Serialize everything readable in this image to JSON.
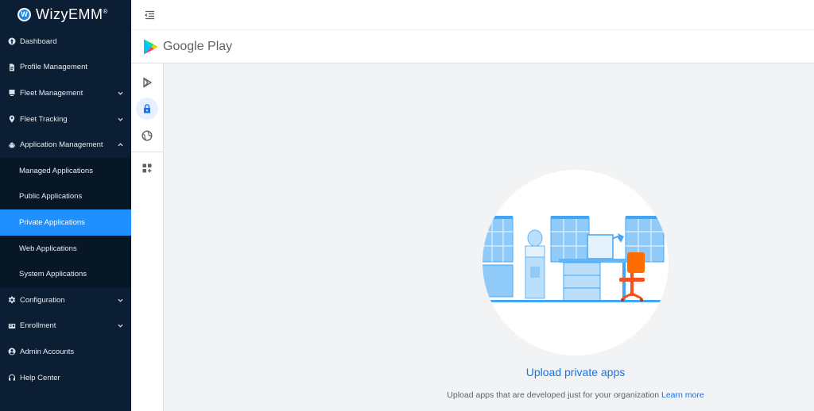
{
  "app": {
    "logo_badge": "W",
    "logo_text": "WizyEMM",
    "logo_mark": "®"
  },
  "sidebar": {
    "items": [
      {
        "label": "Dashboard",
        "icon": "dashboard-icon",
        "expandable": false
      },
      {
        "label": "Profile Management",
        "icon": "document-icon",
        "expandable": false
      },
      {
        "label": "Fleet Management",
        "icon": "fleet-icon",
        "expandable": true,
        "state": "collapsed"
      },
      {
        "label": "Fleet Tracking",
        "icon": "location-pin-icon",
        "expandable": true,
        "state": "collapsed"
      },
      {
        "label": "Application Management",
        "icon": "android-icon",
        "expandable": true,
        "state": "expanded"
      },
      {
        "label": "Configuration",
        "icon": "gear-icon",
        "expandable": true,
        "state": "collapsed"
      },
      {
        "label": "Enrollment",
        "icon": "enrollment-icon",
        "expandable": true,
        "state": "collapsed"
      },
      {
        "label": "Admin Accounts",
        "icon": "user-icon",
        "expandable": false
      },
      {
        "label": "Help Center",
        "icon": "headset-icon",
        "expandable": false
      }
    ],
    "app_management_children": [
      {
        "label": "Managed Applications",
        "active": false
      },
      {
        "label": "Public Applications",
        "active": false
      },
      {
        "label": "Private Applications",
        "active": true
      },
      {
        "label": "Web Applications",
        "active": false
      },
      {
        "label": "System Applications",
        "active": false
      }
    ]
  },
  "topbar": {
    "menu_icon": "menu-collapse-icon"
  },
  "google_play": {
    "title": "Google Play",
    "rail": [
      {
        "icon": "play-store-icon",
        "active": false
      },
      {
        "icon": "lock-icon",
        "active": true
      },
      {
        "icon": "globe-icon",
        "active": false
      },
      {
        "icon": "grid-add-icon",
        "active": false
      }
    ]
  },
  "main": {
    "upload_title": "Upload private apps",
    "upload_desc": "Upload apps that are developed just for your organization",
    "learn_more": "Learn more"
  },
  "colors": {
    "sidebar_bg": "#0b1e33",
    "active_item": "#1e90ff",
    "link": "#1a73e8",
    "content_bg": "#f1f3f4"
  }
}
